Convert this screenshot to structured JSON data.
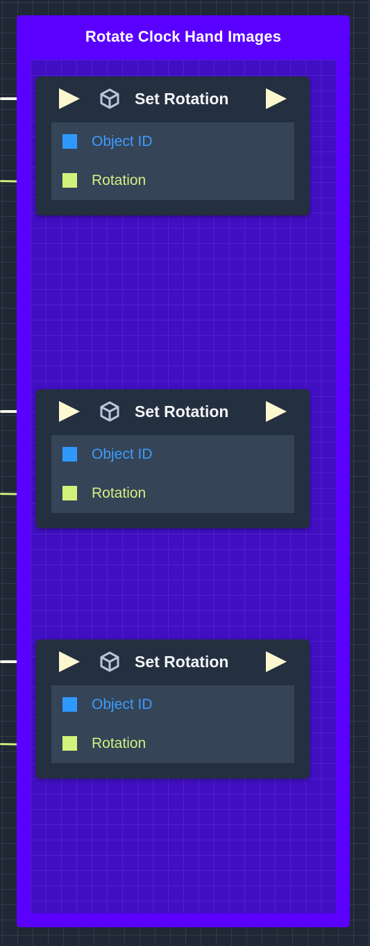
{
  "group": {
    "title": "Rotate Clock Hand Images"
  },
  "nodes": [
    {
      "title": "Set Rotation",
      "icon": "cube-icon",
      "ports": [
        {
          "label": "Object ID",
          "color": "#2f98ff"
        },
        {
          "label": "Rotation",
          "color": "#d3f27c"
        }
      ]
    },
    {
      "title": "Set Rotation",
      "icon": "cube-icon",
      "ports": [
        {
          "label": "Object ID",
          "color": "#2f98ff"
        },
        {
          "label": "Rotation",
          "color": "#d3f27c"
        }
      ]
    },
    {
      "title": "Set Rotation",
      "icon": "cube-icon",
      "ports": [
        {
          "label": "Object ID",
          "color": "#2f98ff"
        },
        {
          "label": "Rotation",
          "color": "#d3f27c"
        }
      ]
    }
  ],
  "colors": {
    "canvas": "#1f2834",
    "group_frame": "#5a00ff",
    "group_body": "#410fc2",
    "node_bg": "#242f3f",
    "exec_pin": "#fdf7d0",
    "exec_wire": "#f4f4ee",
    "data_wire": "#c9ea7c"
  }
}
